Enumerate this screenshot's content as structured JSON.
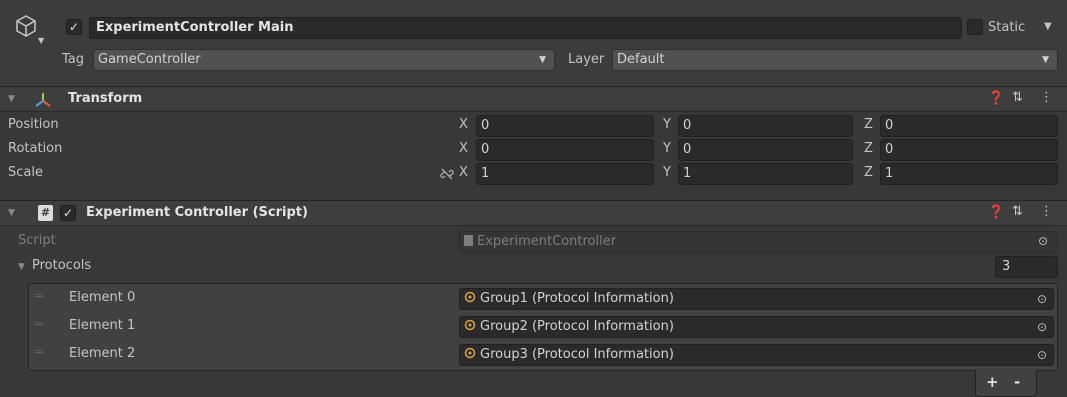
{
  "gameobject": {
    "active": true,
    "name": "ExperimentController Main",
    "static_label": "Static",
    "tag_label": "Tag",
    "tag_value": "GameController",
    "layer_label": "Layer",
    "layer_value": "Default"
  },
  "transform": {
    "title": "Transform",
    "rows": [
      {
        "label": "Position",
        "x": "0",
        "y": "0",
        "z": "0"
      },
      {
        "label": "Rotation",
        "x": "0",
        "y": "0",
        "z": "0"
      },
      {
        "label": "Scale",
        "x": "1",
        "y": "1",
        "z": "1"
      }
    ],
    "axis_x": "X",
    "axis_y": "Y",
    "axis_z": "Z"
  },
  "script_component": {
    "enabled": true,
    "title": "Experiment Controller (Script)",
    "script_label": "Script",
    "script_value": "ExperimentController",
    "protocols_label": "Protocols",
    "protocols_count": "3",
    "elements": [
      {
        "label": "Element 0",
        "value": "Group1 (Protocol Information)"
      },
      {
        "label": "Element 1",
        "value": "Group2 (Protocol Information)"
      },
      {
        "label": "Element 2",
        "value": "Group3 (Protocol Information)"
      }
    ],
    "add_label": "+",
    "remove_label": "-"
  },
  "icons": {
    "gameobject": "cube-icon",
    "transform": "transform-axes-icon",
    "script": "csharp-script-icon",
    "help": "help-icon",
    "presets": "presets-icon",
    "menu": "kebab-menu-icon",
    "link": "constrain-proportions-icon",
    "picker": "object-picker-icon",
    "handle": "drag-handle-icon",
    "dropdown": "dropdown-arrow-icon"
  },
  "colors": {
    "background": "#383838",
    "field": "#2a2a2a",
    "header": "#3e3e3e",
    "text": "#c4c4c4"
  }
}
